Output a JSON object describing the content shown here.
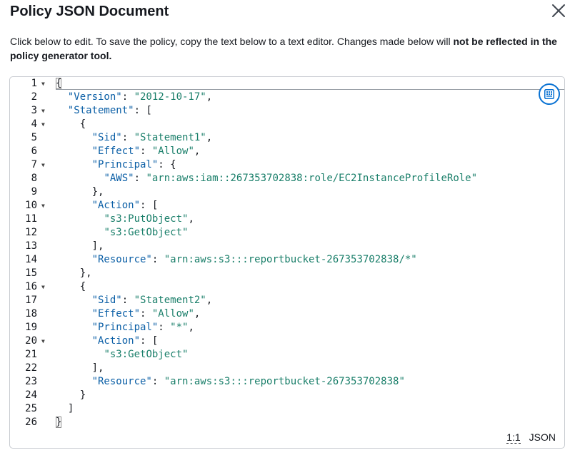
{
  "modal": {
    "title": "Policy JSON Document",
    "description_prefix": "Click below to edit. To save the policy, copy the text below to a text editor. Changes made below will ",
    "description_bold": "not be reflected in the policy generator tool."
  },
  "editor": {
    "lines": [
      {
        "n": "1",
        "fold": true,
        "indent": 0,
        "tokens": [
          {
            "t": "p",
            "v": "{"
          }
        ]
      },
      {
        "n": "2",
        "fold": false,
        "indent": 1,
        "tokens": [
          {
            "t": "key",
            "v": "\"Version\""
          },
          {
            "t": "p",
            "v": ": "
          },
          {
            "t": "str",
            "v": "\"2012-10-17\""
          },
          {
            "t": "p",
            "v": ","
          }
        ]
      },
      {
        "n": "3",
        "fold": true,
        "indent": 1,
        "tokens": [
          {
            "t": "key",
            "v": "\"Statement\""
          },
          {
            "t": "p",
            "v": ": ["
          }
        ]
      },
      {
        "n": "4",
        "fold": true,
        "indent": 2,
        "tokens": [
          {
            "t": "p",
            "v": "{"
          }
        ]
      },
      {
        "n": "5",
        "fold": false,
        "indent": 3,
        "tokens": [
          {
            "t": "key",
            "v": "\"Sid\""
          },
          {
            "t": "p",
            "v": ": "
          },
          {
            "t": "str",
            "v": "\"Statement1\""
          },
          {
            "t": "p",
            "v": ","
          }
        ]
      },
      {
        "n": "6",
        "fold": false,
        "indent": 3,
        "tokens": [
          {
            "t": "key",
            "v": "\"Effect\""
          },
          {
            "t": "p",
            "v": ": "
          },
          {
            "t": "str",
            "v": "\"Allow\""
          },
          {
            "t": "p",
            "v": ","
          }
        ]
      },
      {
        "n": "7",
        "fold": true,
        "indent": 3,
        "tokens": [
          {
            "t": "key",
            "v": "\"Principal\""
          },
          {
            "t": "p",
            "v": ": {"
          }
        ]
      },
      {
        "n": "8",
        "fold": false,
        "indent": 4,
        "tokens": [
          {
            "t": "key",
            "v": "\"AWS\""
          },
          {
            "t": "p",
            "v": ": "
          },
          {
            "t": "str",
            "v": "\"arn:aws:iam::267353702838:role/EC2InstanceProfileRole\""
          }
        ]
      },
      {
        "n": "9",
        "fold": false,
        "indent": 3,
        "tokens": [
          {
            "t": "p",
            "v": "},"
          }
        ]
      },
      {
        "n": "10",
        "fold": true,
        "indent": 3,
        "tokens": [
          {
            "t": "key",
            "v": "\"Action\""
          },
          {
            "t": "p",
            "v": ": ["
          }
        ]
      },
      {
        "n": "11",
        "fold": false,
        "indent": 4,
        "tokens": [
          {
            "t": "str",
            "v": "\"s3:PutObject\""
          },
          {
            "t": "p",
            "v": ","
          }
        ]
      },
      {
        "n": "12",
        "fold": false,
        "indent": 4,
        "tokens": [
          {
            "t": "str",
            "v": "\"s3:GetObject\""
          }
        ]
      },
      {
        "n": "13",
        "fold": false,
        "indent": 3,
        "tokens": [
          {
            "t": "p",
            "v": "],"
          }
        ]
      },
      {
        "n": "14",
        "fold": false,
        "indent": 3,
        "tokens": [
          {
            "t": "key",
            "v": "\"Resource\""
          },
          {
            "t": "p",
            "v": ": "
          },
          {
            "t": "str",
            "v": "\"arn:aws:s3:::reportbucket-267353702838/*\""
          }
        ]
      },
      {
        "n": "15",
        "fold": false,
        "indent": 2,
        "tokens": [
          {
            "t": "p",
            "v": "},"
          }
        ]
      },
      {
        "n": "16",
        "fold": true,
        "indent": 2,
        "tokens": [
          {
            "t": "p",
            "v": "{"
          }
        ]
      },
      {
        "n": "17",
        "fold": false,
        "indent": 3,
        "tokens": [
          {
            "t": "key",
            "v": "\"Sid\""
          },
          {
            "t": "p",
            "v": ": "
          },
          {
            "t": "str",
            "v": "\"Statement2\""
          },
          {
            "t": "p",
            "v": ","
          }
        ]
      },
      {
        "n": "18",
        "fold": false,
        "indent": 3,
        "tokens": [
          {
            "t": "key",
            "v": "\"Effect\""
          },
          {
            "t": "p",
            "v": ": "
          },
          {
            "t": "str",
            "v": "\"Allow\""
          },
          {
            "t": "p",
            "v": ","
          }
        ]
      },
      {
        "n": "19",
        "fold": false,
        "indent": 3,
        "tokens": [
          {
            "t": "key",
            "v": "\"Principal\""
          },
          {
            "t": "p",
            "v": ": "
          },
          {
            "t": "str",
            "v": "\"*\""
          },
          {
            "t": "p",
            "v": ","
          }
        ]
      },
      {
        "n": "20",
        "fold": true,
        "indent": 3,
        "tokens": [
          {
            "t": "key",
            "v": "\"Action\""
          },
          {
            "t": "p",
            "v": ": ["
          }
        ]
      },
      {
        "n": "21",
        "fold": false,
        "indent": 4,
        "tokens": [
          {
            "t": "str",
            "v": "\"s3:GetObject\""
          }
        ]
      },
      {
        "n": "22",
        "fold": false,
        "indent": 3,
        "tokens": [
          {
            "t": "p",
            "v": "],"
          }
        ]
      },
      {
        "n": "23",
        "fold": false,
        "indent": 3,
        "tokens": [
          {
            "t": "key",
            "v": "\"Resource\""
          },
          {
            "t": "p",
            "v": ": "
          },
          {
            "t": "str",
            "v": "\"arn:aws:s3:::reportbucket-267353702838\""
          }
        ]
      },
      {
        "n": "24",
        "fold": false,
        "indent": 2,
        "tokens": [
          {
            "t": "p",
            "v": "}"
          }
        ]
      },
      {
        "n": "25",
        "fold": false,
        "indent": 1,
        "tokens": [
          {
            "t": "p",
            "v": "]"
          }
        ]
      },
      {
        "n": "26",
        "fold": false,
        "indent": 0,
        "tokens": [
          {
            "t": "p",
            "v": "}"
          }
        ]
      }
    ],
    "highlighted_lines": [
      "1",
      "26"
    ],
    "status": {
      "cursor_position": "1:1",
      "language": "JSON"
    },
    "settings_icon": "keyboard-icon"
  },
  "colors": {
    "accent": "#0972d3",
    "key": "#0b5fa6",
    "string": "#1a7f6a"
  }
}
